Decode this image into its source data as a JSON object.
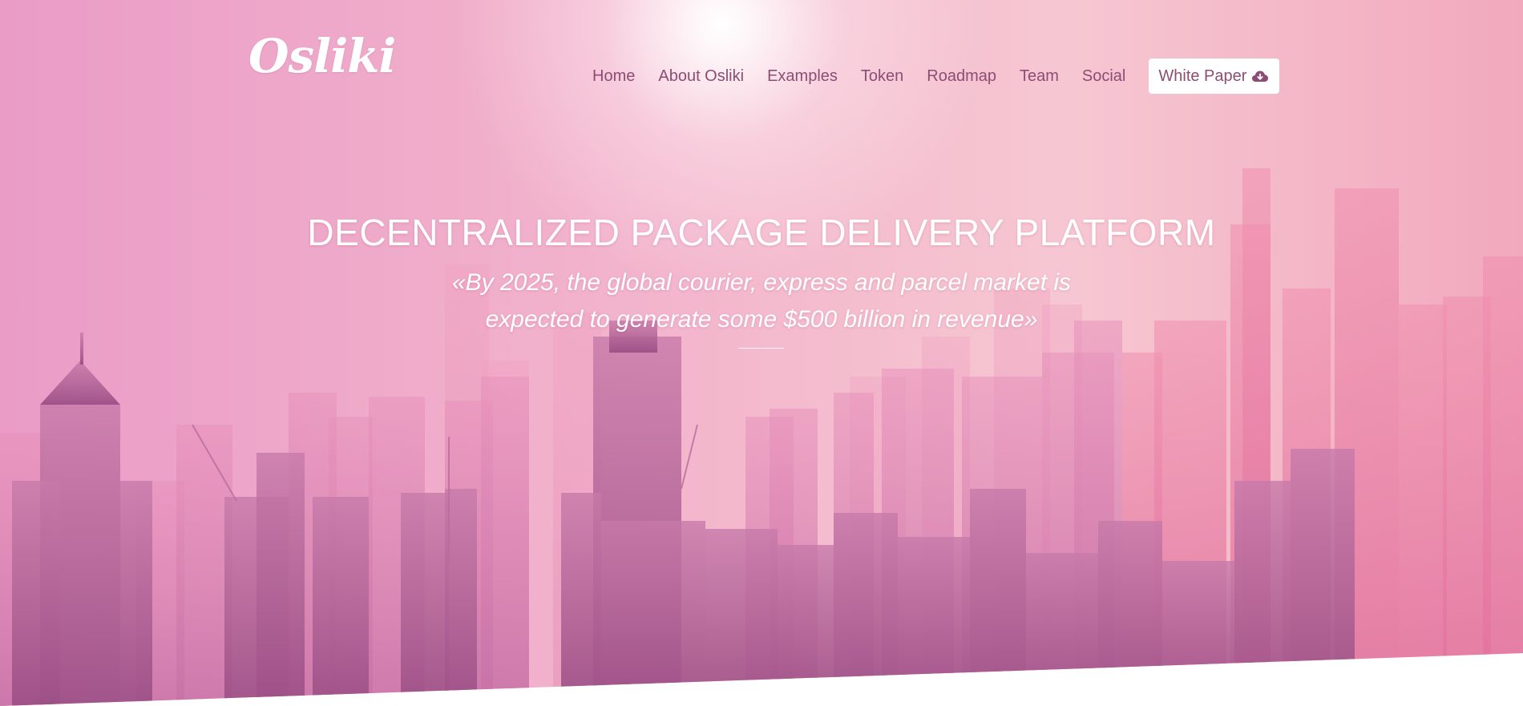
{
  "header": {
    "logo": "Osliki",
    "nav": [
      {
        "label": "Home"
      },
      {
        "label": "About Osliki"
      },
      {
        "label": "Examples"
      },
      {
        "label": "Token"
      },
      {
        "label": "Roadmap"
      },
      {
        "label": "Team"
      },
      {
        "label": "Social"
      }
    ],
    "white_paper_label": "White Paper",
    "white_paper_icon": "cloud-download-icon"
  },
  "hero": {
    "title": "DECENTRALIZED PACKAGE DELIVERY PLATFORM",
    "quote": "«By 2025, the global courier, express and parcel market is expected to generate some $500 billion in revenue»"
  },
  "colors": {
    "nav_text": "#8d4d73",
    "button_bg": "#ffffff",
    "hero_text": "#ffffff"
  }
}
